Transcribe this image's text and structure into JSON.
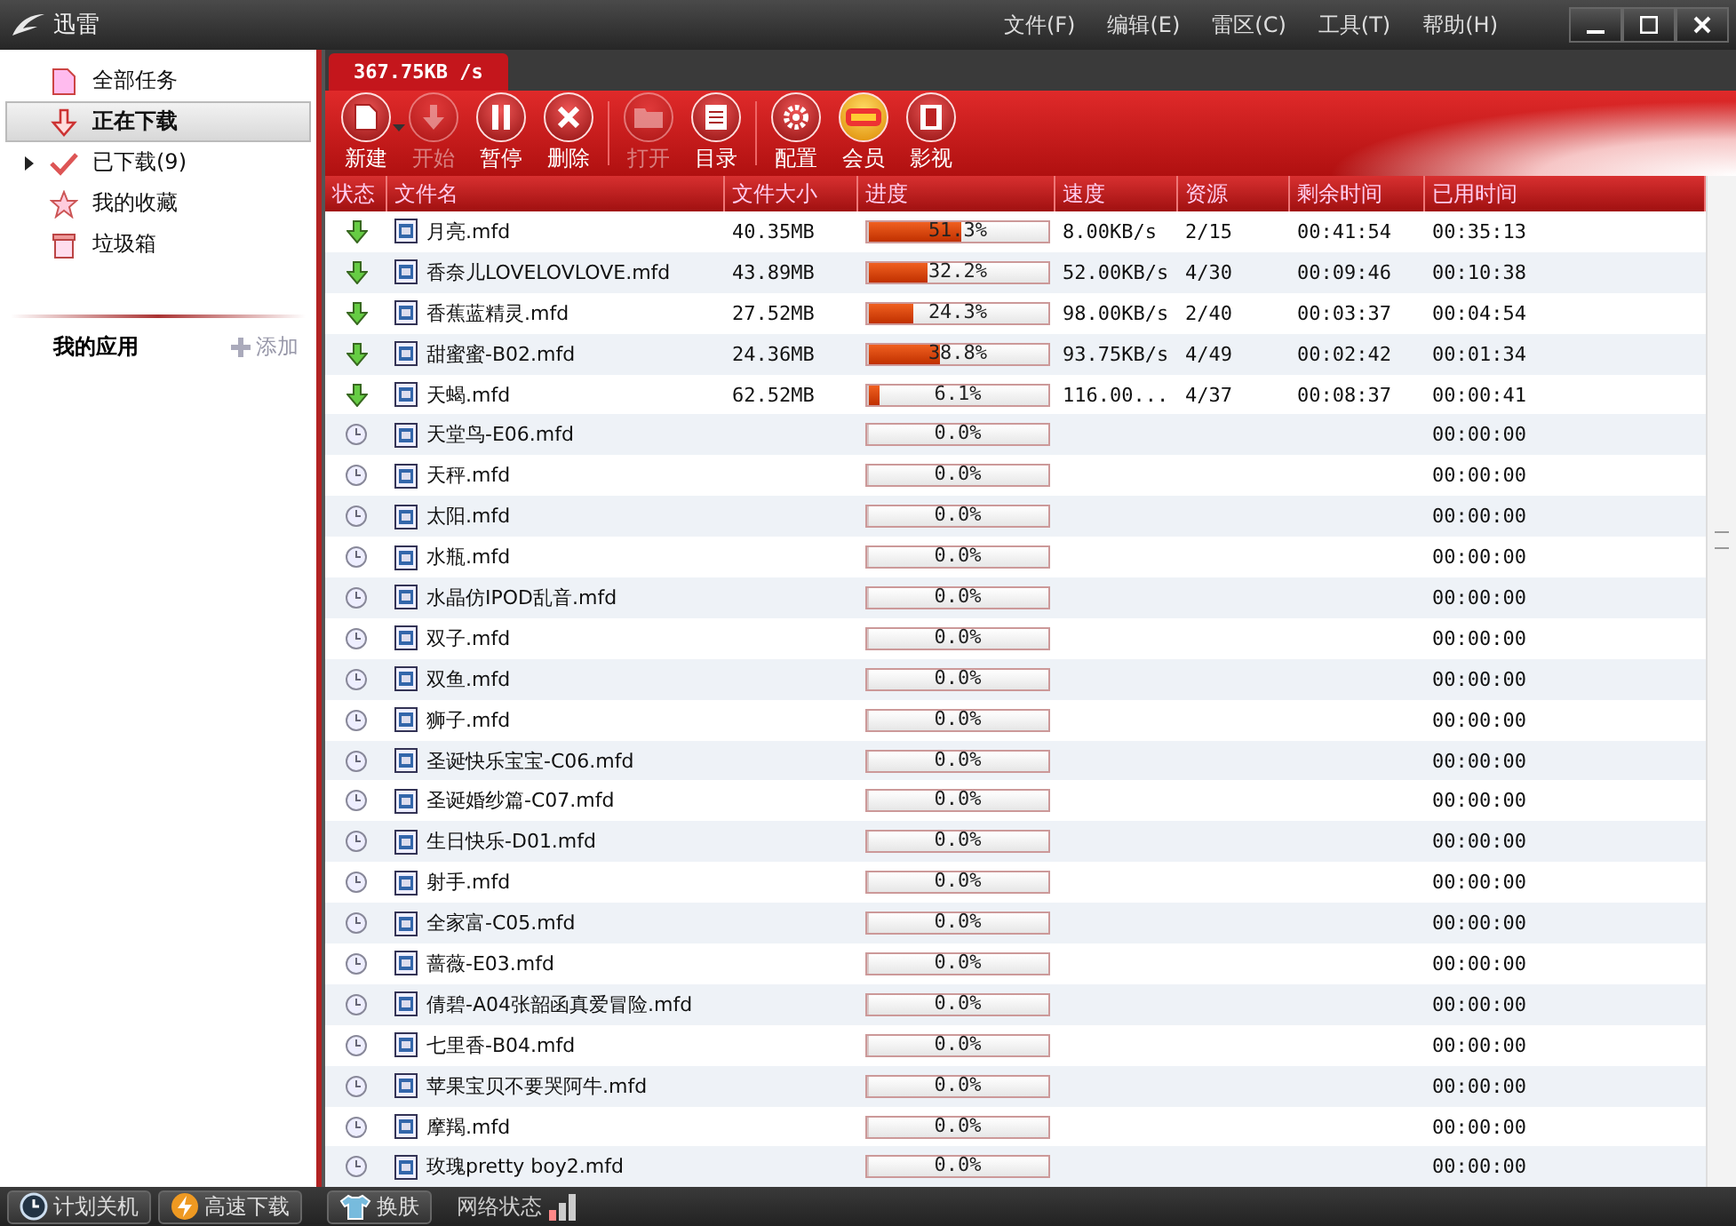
{
  "window": {
    "title": "迅雷"
  },
  "menu": [
    "文件(F)",
    "编辑(E)",
    "雷区(C)",
    "工具(T)",
    "帮助(H)"
  ],
  "sidebar": {
    "items": [
      {
        "kind": "all",
        "label": "全部任务",
        "selected": false
      },
      {
        "kind": "downloading",
        "label": "正在下载",
        "selected": true
      },
      {
        "kind": "done",
        "label": "已下载",
        "count": "(9)",
        "selected": false,
        "expanded": false
      },
      {
        "kind": "favorite",
        "label": "我的收藏",
        "selected": false
      },
      {
        "kind": "trash",
        "label": "垃圾箱",
        "selected": false
      }
    ],
    "apps": {
      "title": "我的应用",
      "add": "添加"
    }
  },
  "speed_tab": "367.75KB /s",
  "toolbar": [
    {
      "kind": "new",
      "label": "新建",
      "disabled": false,
      "dropdown": true
    },
    {
      "kind": "start",
      "label": "开始",
      "disabled": true
    },
    {
      "kind": "pause",
      "label": "暂停",
      "disabled": false
    },
    {
      "kind": "delete",
      "label": "删除",
      "disabled": false
    },
    {
      "kind": "open",
      "label": "打开",
      "disabled": true
    },
    {
      "kind": "folder",
      "label": "目录",
      "disabled": false
    },
    {
      "kind": "settings",
      "label": "配置",
      "disabled": false
    },
    {
      "kind": "vip",
      "label": "会员",
      "disabled": false
    },
    {
      "kind": "video",
      "label": "影视",
      "disabled": false
    }
  ],
  "table": {
    "columns": [
      "状态",
      "文件名",
      "文件大小",
      "进度",
      "速度",
      "资源",
      "剩余时间",
      "已用时间"
    ],
    "rows": [
      {
        "kind": "downloading",
        "name": "月亮.mfd",
        "size": "40.35MB",
        "level": 0.513,
        "progress": "51.3%",
        "speed": "8.00KB/s",
        "sources": "2/15",
        "remaining": "00:41:54",
        "elapsed": "00:35:13"
      },
      {
        "kind": "downloading",
        "name": "香奈儿LOVELOVLOVE.mfd",
        "size": "43.89MB",
        "level": 0.322,
        "progress": "32.2%",
        "speed": "52.00KB/s",
        "sources": "4/30",
        "remaining": "00:09:46",
        "elapsed": "00:10:38"
      },
      {
        "kind": "downloading",
        "name": "香蕉蓝精灵.mfd",
        "size": "27.52MB",
        "level": 0.243,
        "progress": "24.3%",
        "speed": "98.00KB/s",
        "sources": "2/40",
        "remaining": "00:03:37",
        "elapsed": "00:04:54"
      },
      {
        "kind": "downloading",
        "name": "甜蜜蜜-B02.mfd",
        "size": "24.36MB",
        "level": 0.388,
        "progress": "38.8%",
        "speed": "93.75KB/s",
        "sources": "4/49",
        "remaining": "00:02:42",
        "elapsed": "00:01:34"
      },
      {
        "kind": "downloading",
        "name": "天蝎.mfd",
        "size": "62.52MB",
        "level": 0.061,
        "progress": "6.1%",
        "speed": "116.00...",
        "sources": "4/37",
        "remaining": "00:08:37",
        "elapsed": "00:00:41"
      },
      {
        "kind": "waiting",
        "name": "天堂鸟-E06.mfd",
        "level": 0,
        "progress": "0.0%",
        "elapsed": "00:00:00"
      },
      {
        "kind": "waiting",
        "name": "天秤.mfd",
        "level": 0,
        "progress": "0.0%",
        "elapsed": "00:00:00"
      },
      {
        "kind": "waiting",
        "name": "太阳.mfd",
        "level": 0,
        "progress": "0.0%",
        "elapsed": "00:00:00"
      },
      {
        "kind": "waiting",
        "name": "水瓶.mfd",
        "level": 0,
        "progress": "0.0%",
        "elapsed": "00:00:00"
      },
      {
        "kind": "waiting",
        "name": "水晶仿IPOD乱音.mfd",
        "level": 0,
        "progress": "0.0%",
        "elapsed": "00:00:00"
      },
      {
        "kind": "waiting",
        "name": "双子.mfd",
        "level": 0,
        "progress": "0.0%",
        "elapsed": "00:00:00"
      },
      {
        "kind": "waiting",
        "name": "双鱼.mfd",
        "level": 0,
        "progress": "0.0%",
        "elapsed": "00:00:00"
      },
      {
        "kind": "waiting",
        "name": "狮子.mfd",
        "level": 0,
        "progress": "0.0%",
        "elapsed": "00:00:00"
      },
      {
        "kind": "waiting",
        "name": "圣诞快乐宝宝-C06.mfd",
        "level": 0,
        "progress": "0.0%",
        "elapsed": "00:00:00"
      },
      {
        "kind": "waiting",
        "name": "圣诞婚纱篇-C07.mfd",
        "level": 0,
        "progress": "0.0%",
        "elapsed": "00:00:00"
      },
      {
        "kind": "waiting",
        "name": "生日快乐-D01.mfd",
        "level": 0,
        "progress": "0.0%",
        "elapsed": "00:00:00"
      },
      {
        "kind": "waiting",
        "name": "射手.mfd",
        "level": 0,
        "progress": "0.0%",
        "elapsed": "00:00:00"
      },
      {
        "kind": "waiting",
        "name": "全家富-C05.mfd",
        "level": 0,
        "progress": "0.0%",
        "elapsed": "00:00:00"
      },
      {
        "kind": "waiting",
        "name": "蔷薇-E03.mfd",
        "level": 0,
        "progress": "0.0%",
        "elapsed": "00:00:00"
      },
      {
        "kind": "waiting",
        "name": "倩碧-A04张韶函真爱冒险.mfd",
        "level": 0,
        "progress": "0.0%",
        "elapsed": "00:00:00"
      },
      {
        "kind": "waiting",
        "name": "七里香-B04.mfd",
        "level": 0,
        "progress": "0.0%",
        "elapsed": "00:00:00"
      },
      {
        "kind": "waiting",
        "name": "苹果宝贝不要哭阿牛.mfd",
        "level": 0,
        "progress": "0.0%",
        "elapsed": "00:00:00"
      },
      {
        "kind": "waiting",
        "name": "摩羯.mfd",
        "level": 0,
        "progress": "0.0%",
        "elapsed": "00:00:00"
      },
      {
        "kind": "waiting",
        "name": "玫瑰pretty boy2.mfd",
        "level": 0,
        "progress": "0.0%",
        "elapsed": "00:00:00"
      }
    ]
  },
  "status_bar": {
    "buttons": [
      {
        "kind": "clock",
        "label": "计划关机"
      },
      {
        "kind": "bolt",
        "label": "高速下载"
      },
      {
        "kind": "shirt",
        "label": "换肤"
      }
    ],
    "network": "网络状态"
  }
}
